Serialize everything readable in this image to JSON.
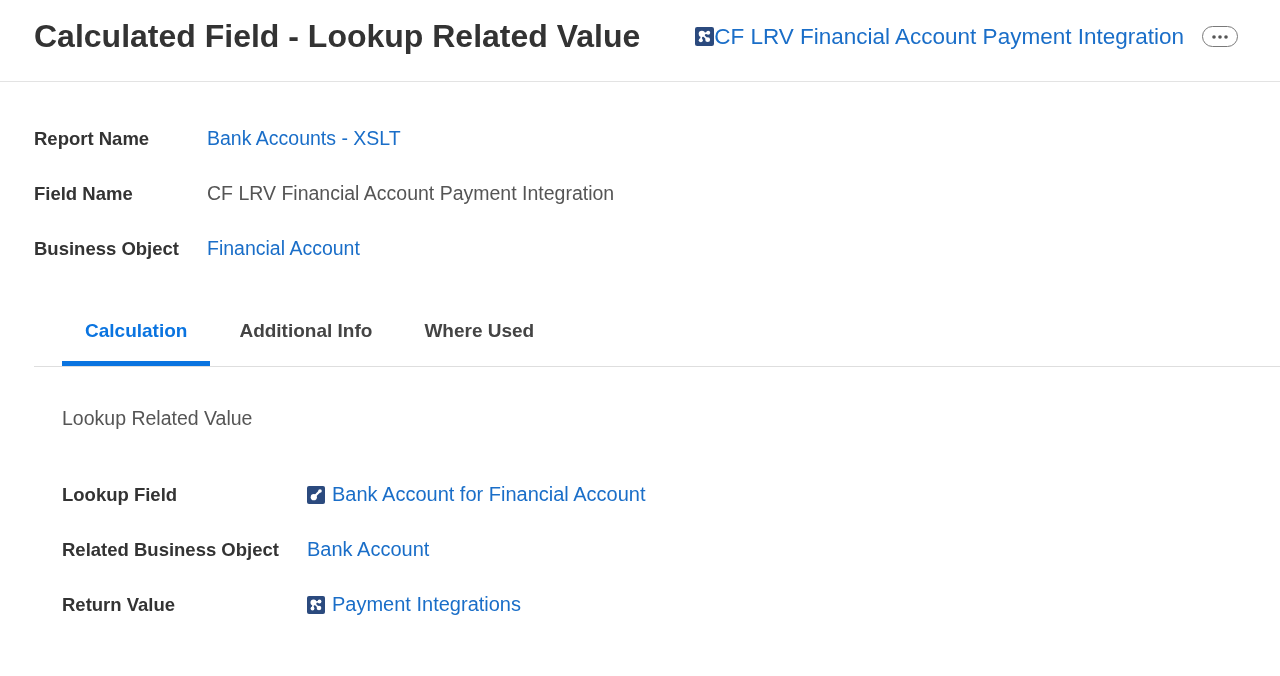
{
  "header": {
    "title": "Calculated Field - Lookup Related Value",
    "link": {
      "kind": "multi-instance",
      "text": "CF LRV Financial Account Payment Integration"
    }
  },
  "details": [
    {
      "label": "Report Name",
      "value": "Bank Accounts - XSLT",
      "link": true
    },
    {
      "label": "Field Name",
      "value": "CF LRV Financial Account Payment Integration",
      "link": false
    },
    {
      "label": "Business Object",
      "value": "Financial Account",
      "link": true
    }
  ],
  "tabs": [
    {
      "label": "Calculation",
      "selected": true
    },
    {
      "label": "Additional Info",
      "selected": false
    },
    {
      "label": "Where Used",
      "selected": false
    }
  ],
  "calculation": {
    "type_label": "Lookup Related Value",
    "fields": [
      {
        "label": "Lookup Field",
        "value": {
          "kind": "single-instance",
          "text": "Bank Account for Financial Account"
        }
      },
      {
        "label": "Related Business Object",
        "value": {
          "kind": "plain",
          "text": "Bank Account"
        }
      },
      {
        "label": "Return Value",
        "value": {
          "kind": "multi-instance",
          "text": "Payment Integrations"
        }
      }
    ]
  }
}
